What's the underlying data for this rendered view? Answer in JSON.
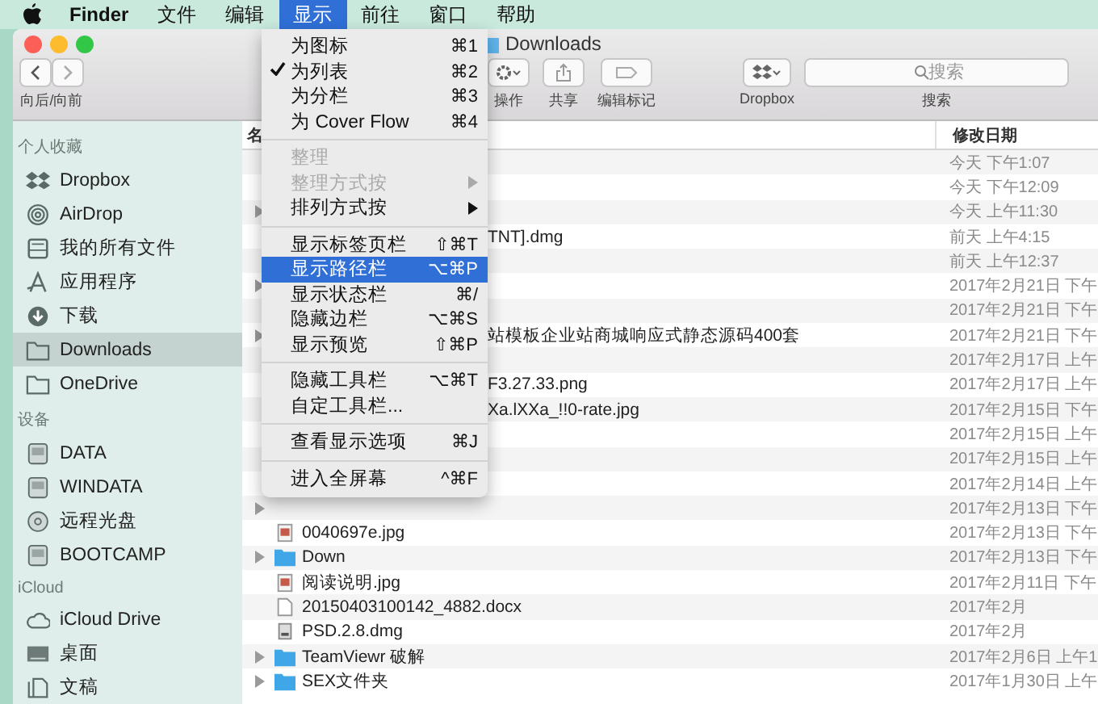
{
  "menubar": {
    "app": "Finder",
    "items": [
      {
        "label": "文件",
        "selected": false
      },
      {
        "label": "编辑",
        "selected": false
      },
      {
        "label": "显示",
        "selected": true
      },
      {
        "label": "前往",
        "selected": false
      },
      {
        "label": "窗口",
        "selected": false
      },
      {
        "label": "帮助",
        "selected": false
      }
    ]
  },
  "view_menu": [
    {
      "kind": "item",
      "label": "为图标",
      "shortcut": "⌘1",
      "checked": false,
      "disabled": false,
      "selected": false
    },
    {
      "kind": "item",
      "label": "为列表",
      "shortcut": "⌘2",
      "checked": true,
      "disabled": false,
      "selected": false
    },
    {
      "kind": "item",
      "label": "为分栏",
      "shortcut": "⌘3",
      "checked": false,
      "disabled": false,
      "selected": false
    },
    {
      "kind": "item",
      "label": "为 Cover Flow",
      "shortcut": "⌘4",
      "checked": false,
      "disabled": false,
      "selected": false
    },
    {
      "kind": "separator"
    },
    {
      "kind": "item",
      "label": "整理",
      "checked": false,
      "disabled": true,
      "selected": false
    },
    {
      "kind": "submenu",
      "label": "整理方式按",
      "checked": false,
      "disabled": true,
      "selected": false
    },
    {
      "kind": "submenu",
      "label": "排列方式按",
      "checked": false,
      "disabled": false,
      "selected": false
    },
    {
      "kind": "separator"
    },
    {
      "kind": "item",
      "label": "显示标签页栏",
      "shortcut": "⇧⌘T",
      "checked": false,
      "disabled": false,
      "selected": false
    },
    {
      "kind": "item",
      "label": "显示路径栏",
      "shortcut": "⌥⌘P",
      "checked": false,
      "disabled": false,
      "selected": true
    },
    {
      "kind": "item",
      "label": "显示状态栏",
      "shortcut": "⌘/",
      "checked": false,
      "disabled": false,
      "selected": false
    },
    {
      "kind": "item",
      "label": "隐藏边栏",
      "shortcut": "⌥⌘S",
      "checked": false,
      "disabled": false,
      "selected": false
    },
    {
      "kind": "item",
      "label": "显示预览",
      "shortcut": "⇧⌘P",
      "checked": false,
      "disabled": false,
      "selected": false
    },
    {
      "kind": "separator"
    },
    {
      "kind": "item",
      "label": "隐藏工具栏",
      "shortcut": "⌥⌘T",
      "checked": false,
      "disabled": false,
      "selected": false
    },
    {
      "kind": "item",
      "label": "自定工具栏...",
      "checked": false,
      "disabled": false,
      "selected": false
    },
    {
      "kind": "separator"
    },
    {
      "kind": "item",
      "label": "查看显示选项",
      "shortcut": "⌘J",
      "checked": false,
      "disabled": false,
      "selected": false
    },
    {
      "kind": "separator"
    },
    {
      "kind": "item",
      "label": "进入全屏幕",
      "shortcut": "^⌘F",
      "checked": false,
      "disabled": false,
      "selected": false
    }
  ],
  "window": {
    "title": "Downloads"
  },
  "toolbar": {
    "nav_label": "向后/向前",
    "action_label": "操作",
    "share_label": "共享",
    "tags_label": "编辑标记",
    "dropbox_label": "Dropbox",
    "search": {
      "placeholder": "搜索",
      "label": "搜索"
    }
  },
  "sidebar": [
    {
      "heading": "个人收藏",
      "items": [
        {
          "kind": "dropbox",
          "label": "Dropbox",
          "selected": false
        },
        {
          "kind": "airdrop",
          "label": "AirDrop",
          "selected": false
        },
        {
          "kind": "allfiles",
          "label": "我的所有文件",
          "selected": false
        },
        {
          "kind": "apps",
          "label": "应用程序",
          "selected": false
        },
        {
          "kind": "download",
          "label": "下载",
          "selected": false
        },
        {
          "kind": "folder",
          "label": "Downloads",
          "selected": true
        },
        {
          "kind": "folder",
          "label": "OneDrive",
          "selected": false
        }
      ]
    },
    {
      "heading": "设备",
      "items": [
        {
          "kind": "disk",
          "label": "DATA",
          "selected": false
        },
        {
          "kind": "disk",
          "label": "WINDATA",
          "selected": false
        },
        {
          "kind": "disc",
          "label": "远程光盘",
          "selected": false
        },
        {
          "kind": "disk",
          "label": "BOOTCAMP",
          "selected": false
        }
      ]
    },
    {
      "heading": "iCloud",
      "items": [
        {
          "kind": "cloud",
          "label": "iCloud Drive",
          "selected": false
        },
        {
          "kind": "desktop",
          "label": "桌面",
          "selected": false
        },
        {
          "kind": "document",
          "label": "文稿",
          "selected": false
        }
      ]
    }
  ],
  "table": {
    "columns": [
      "名",
      "修改日期"
    ],
    "rows": [
      {
        "date": "今天 下午1:07"
      },
      {
        "date": "今天 下午12:09"
      },
      {
        "expandable": true,
        "date": "今天 上午11:30"
      },
      {
        "name": "TNT].dmg",
        "clipped": true,
        "date": "前天 上午4:15"
      },
      {
        "date": "前天 上午12:37"
      },
      {
        "expandable": true,
        "date": "2017年2月21日 下午"
      },
      {
        "date": "2017年2月21日 下午"
      },
      {
        "expandable": true,
        "name": "站模板企业站商城响应式静态源码400套",
        "clipped": true,
        "date": "2017年2月21日 下午"
      },
      {
        "date": "2017年2月17日 上午"
      },
      {
        "name": "F3.27.33.png",
        "clipped": true,
        "date": "2017年2月17日 上午"
      },
      {
        "name": "Xa.lXXa_!!0-rate.jpg",
        "clipped": true,
        "date": "2017年2月15日 下午"
      },
      {
        "date": "2017年2月15日 上午"
      },
      {
        "date": "2017年2月15日 上午"
      },
      {
        "date": "2017年2月14日 上午"
      },
      {
        "expandable": true,
        "date": "2017年2月13日 下午"
      },
      {
        "kind": "image",
        "name": "0040697e.jpg",
        "date": "2017年2月13日 下午"
      },
      {
        "expandable": true,
        "kind": "folder",
        "name": "Down",
        "date": "2017年2月13日 下午"
      },
      {
        "kind": "image",
        "name": "阅读说明.jpg",
        "date": "2017年2月11日 下午"
      },
      {
        "kind": "document",
        "name": "20150403100142_4882.docx",
        "date": "2017年2月"
      },
      {
        "kind": "dmg",
        "name": "PSD.2.8.dmg",
        "date": "2017年2月"
      },
      {
        "expandable": true,
        "kind": "folder",
        "name": "TeamViewr 破解",
        "date": "2017年2月6日 上午1"
      },
      {
        "expandable": true,
        "kind": "folder",
        "name": "SEX文件夹",
        "date": "2017年1月30日 上午"
      }
    ]
  }
}
